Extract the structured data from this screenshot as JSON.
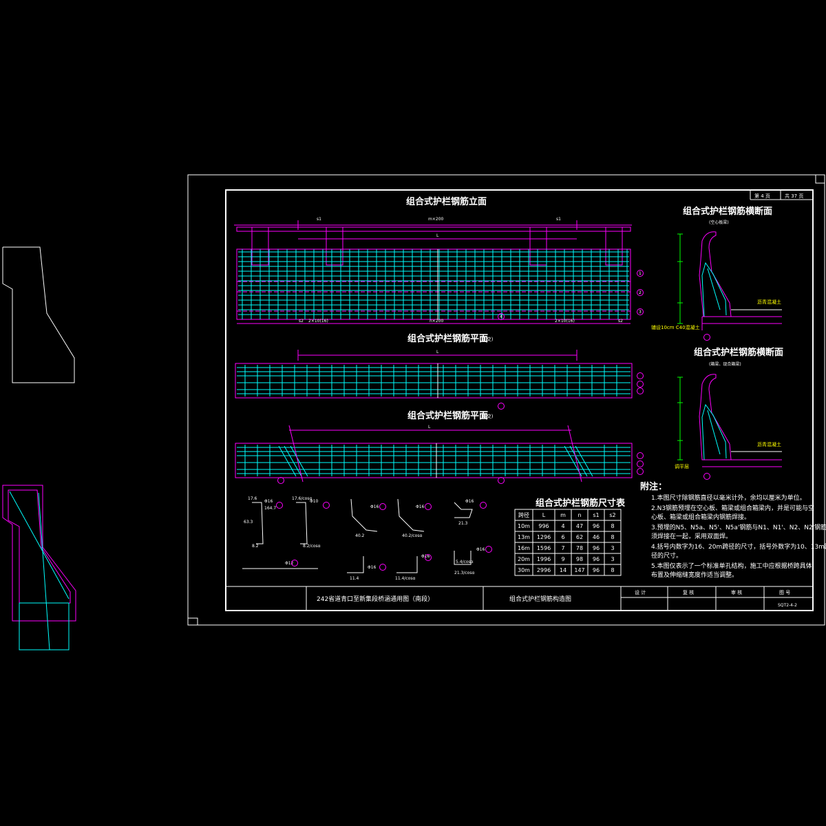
{
  "sheet": {
    "page_no": "第 4 页",
    "page_total": "共 37 页",
    "project_title": "242省道青口至新集段桥涵通用图（南段）",
    "drawing_title": "组合式护栏钢筋构造图",
    "sign_design": "设 计",
    "sign_review": "复 核",
    "sign_audit": "审 核",
    "sign_drawing_no": "图 号",
    "drawing_no": "SQT2-4-2"
  },
  "views": {
    "elevation_title": "组合式护栏钢筋立面",
    "plan_straight_title": "组合式护栏钢筋平面",
    "plan_straight_suffix": "(正交)",
    "plan_skew_title": "组合式护栏钢筋平面",
    "plan_skew_suffix": "(斜交)",
    "section1_title": "组合式护栏钢筋横断面",
    "section1_sub": "(空心板梁)",
    "section2_title": "组合式护栏钢筋横断面",
    "section2_sub": "(箱梁、现合箱梁)",
    "dim_s1": "s1",
    "dim_m200": "m×200",
    "dim_L": "L",
    "dim_n200": "n×200",
    "dim_s2": "s2",
    "dim_2x10": "2×10(16)",
    "dim_4": "4",
    "label_asphalt": "沥青混凝土",
    "label_concrete": "铺设10cm C40混凝土",
    "label_level": "调平层"
  },
  "callouts": [
    "1",
    "2",
    "3",
    "4"
  ],
  "bar_shapes": {
    "b1_dim1": "17.6",
    "b1_dia": "Φ16",
    "b1_len": "164.7",
    "b1_v1": "18.7",
    "b1_v2": "63.3",
    "b1_v3": "85.1",
    "b1_v4": "8.2",
    "b1p_dim1": "17.6/cosα",
    "b1p_dia": "Φ10",
    "b1p_v1": "18.7",
    "b1p_v2": "63.3",
    "b1p_v3": "85.1",
    "b1p_v4": "8.2/cosα",
    "b2_dia": "Φ16",
    "b2_v1": "10",
    "b2_v2": "38.6",
    "b2_v3": "87",
    "b2_v4": "40.2",
    "b2_v5": "16.3",
    "b2p_dia": "Φ16",
    "b2p_v1": "10",
    "b2p_v2": "53.1",
    "b2p_v3": "87",
    "b2p_v4": "40.2/cosα",
    "b3_dia": "Φ16",
    "b3_v1": "3.6",
    "b3_v2": "21.3",
    "b3_v3": "3.2",
    "b3_v4": "16.5",
    "b4_dia": "Φ12",
    "b5_dia": "Φ16",
    "b5_v1": "11.4",
    "b5_v2": "51.4",
    "b5_v3": "8",
    "b5p_dia": "Φ16",
    "b5p_v1": "11.4/cosα",
    "b5p_v2": "32",
    "b6_dia": "Φ16",
    "b6_v1": "5.4/cosα",
    "b6_v2": "21.3/cosα",
    "b6_v3": "32"
  },
  "table": {
    "title": "组合式护栏钢筋尺寸表",
    "headers": [
      "跨径",
      "L",
      "m",
      "n",
      "s1",
      "s2"
    ],
    "rows": [
      [
        "10m",
        "996",
        "4",
        "47",
        "96",
        "8"
      ],
      [
        "13m",
        "1296",
        "6",
        "62",
        "46",
        "8"
      ],
      [
        "16m",
        "1596",
        "7",
        "78",
        "96",
        "3"
      ],
      [
        "20m",
        "1996",
        "9",
        "98",
        "96",
        "3"
      ],
      [
        "30m",
        "2996",
        "14",
        "147",
        "96",
        "8"
      ]
    ]
  },
  "notes": {
    "heading": "附注：",
    "lines": [
      "1.本图尺寸除钢筋直径以毫米计外，余均以厘米为单位。",
      "2.N3钢筋预埋在空心板、箱梁或组合箱梁内，并是可能与空",
      "  心板、箱梁或组合箱梁内钢筋焊接。",
      "3.预埋的N5、N5a、N5'、N5a'钢筋与N1、N1'、N2、N2'钢筋",
      "  须焊接在一起，采用双面焊。",
      "4.括号内数字为16、20m跨径的尺寸，括号外数字为10、13m跨",
      "  径的尺寸。",
      "5.本图仅表示了一个标准单孔结构，施工中应根据桥跨具体",
      "  布置及伸缩缝宽度作适当调整。"
    ]
  },
  "colors": {
    "frame": "#ffffff",
    "magenta": "#ff00ff",
    "cyan": "#00ffff",
    "yellow": "#ffff00",
    "green": "#00ff00"
  }
}
